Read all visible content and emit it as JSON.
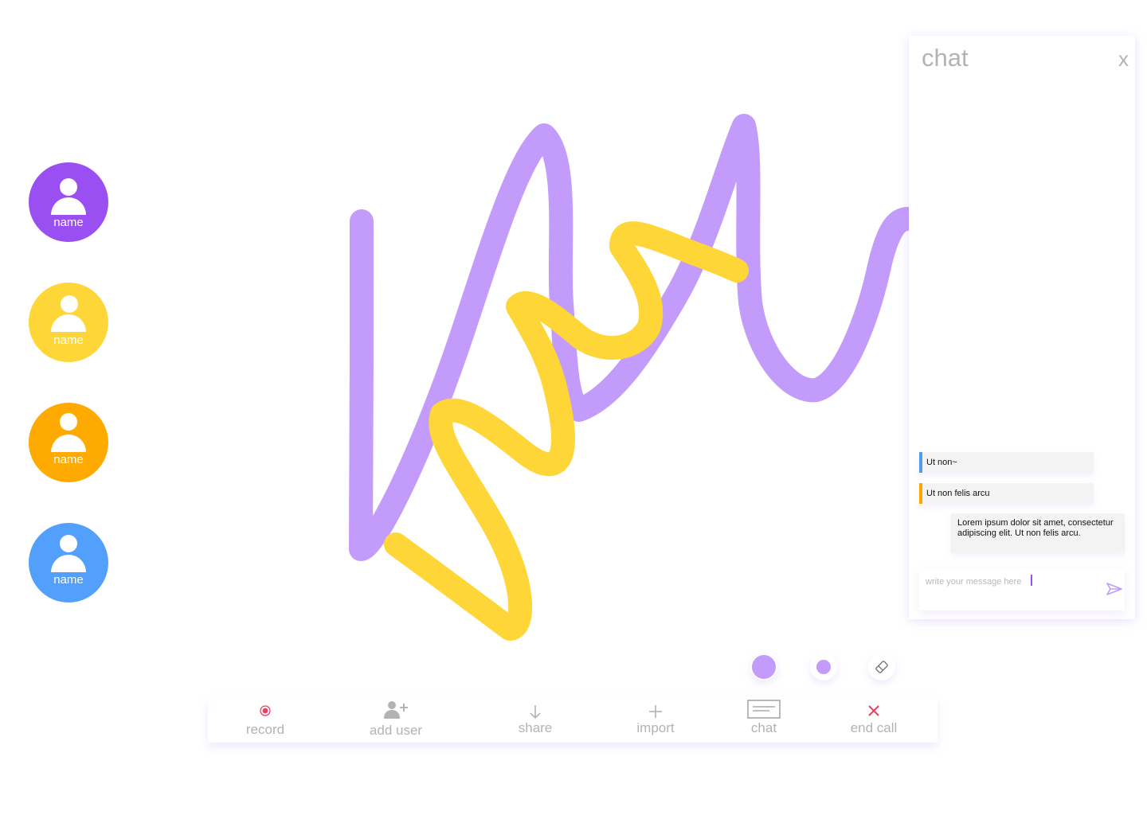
{
  "participants": [
    {
      "name": "name",
      "color": "#9a4ff2"
    },
    {
      "name": "name",
      "color": "#ffd638"
    },
    {
      "name": "name",
      "color": "#ffaa00"
    },
    {
      "name": "name",
      "color": "#52a0fb"
    }
  ],
  "strokes": [
    {
      "color": "#c39bfa"
    },
    {
      "color": "#ffd638"
    }
  ],
  "chat": {
    "title": "chat",
    "close_label": "x",
    "messages": [
      {
        "text": "Ut non~",
        "accent": "#4f9bf0"
      },
      {
        "text": "Ut non felis arcu",
        "accent": "#ffa500"
      }
    ],
    "own_message": "Lorem ipsum dolor sit amet, consectetur adipiscing elit. Ut non felis arcu.",
    "input_placeholder": "write your message here",
    "send_icon": "send-icon"
  },
  "tools": {
    "pen_color": "#c39bfa",
    "eraser_icon": "eraser-icon"
  },
  "toolbar": {
    "record_label": "record",
    "record_color": "#e8405f",
    "add_user_label": "add user",
    "share_label": "share",
    "import_label": "import",
    "chat_label": "chat",
    "end_call_label": "end call",
    "end_call_color": "#e8405f"
  }
}
